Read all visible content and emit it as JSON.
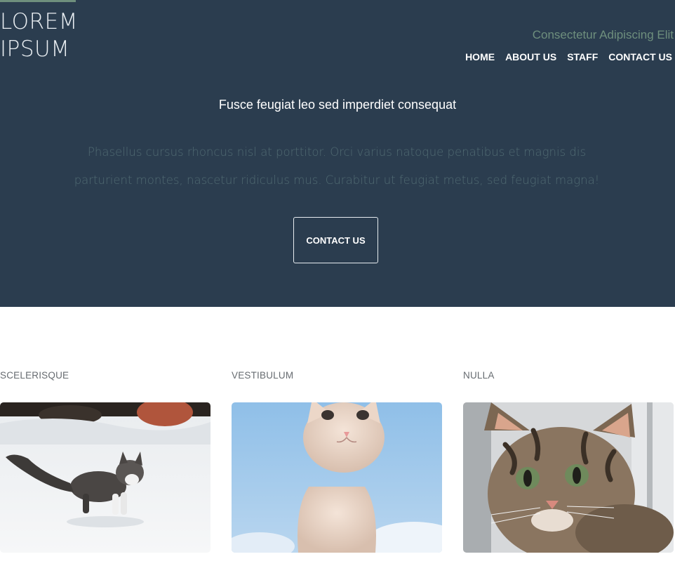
{
  "header": {
    "logo_line1": "LOREM",
    "logo_line2": "IPSUM",
    "tagline": "Consectetur Adipiscing Elit",
    "nav": [
      "HOME",
      "ABOUT US",
      "STAFF",
      "CONTACT US"
    ]
  },
  "hero": {
    "heading": "Fusce feugiat leo sed imperdiet consequat",
    "text": "Phasellus cursus rhoncus nisl at porttitor. Orci varius natoque penatibus et magnis dis parturient montes, nascetur ridiculus mus. Curabitur ut feugiat metus, sed feugiat magna!",
    "cta_label": "CONTACT US"
  },
  "cards": [
    {
      "title": "SCELERISQUE",
      "image": "tabby-kitten-in-snow-photo"
    },
    {
      "title": "VESTIBULUM",
      "image": "white-kitten-against-sky-photo"
    },
    {
      "title": "NULLA",
      "image": "tabby-kitten-by-window-photo"
    }
  ],
  "colors": {
    "hero_background": "#2b3d4f",
    "accent": "#6e8f7d",
    "muted_text": "#506a72"
  }
}
